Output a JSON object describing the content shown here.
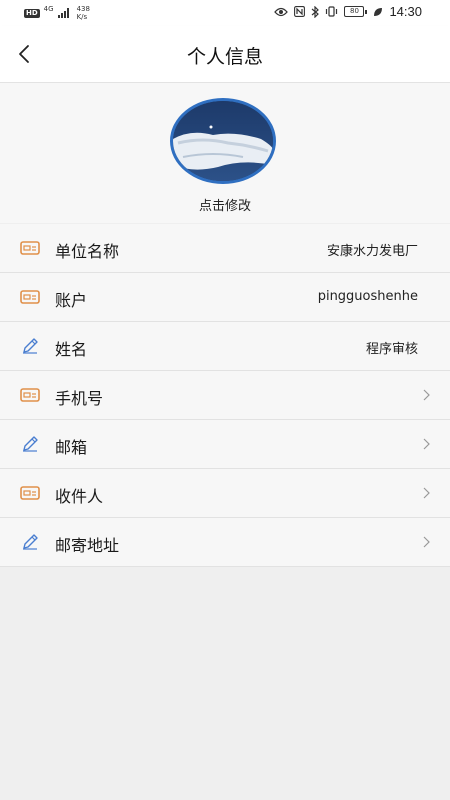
{
  "status_bar": {
    "hd": "HD",
    "network": "4G",
    "speed": "438\nK/s",
    "battery": "80",
    "time": "14:30",
    "icons": [
      "eye-icon",
      "nfc-icon",
      "bluetooth-icon",
      "vibrate-icon",
      "battery-icon",
      "leaf-icon"
    ]
  },
  "header": {
    "title": "个人信息",
    "back_icon": "chevron-left-icon"
  },
  "avatar": {
    "hint": "点击修改"
  },
  "rows": [
    {
      "label": "单位名称",
      "value": "安康水力发电厂",
      "icon": "id-card-icon",
      "chevron": false
    },
    {
      "label": "账户",
      "value": "pingguoshenhe",
      "icon": "id-card-icon",
      "chevron": false
    },
    {
      "label": "姓名",
      "value": "程序审核",
      "icon": "pencil-icon",
      "chevron": false
    },
    {
      "label": "手机号",
      "value": "",
      "icon": "id-card-icon",
      "chevron": true
    },
    {
      "label": "邮箱",
      "value": "",
      "icon": "pencil-icon",
      "chevron": true
    },
    {
      "label": "收件人",
      "value": "",
      "icon": "id-card-icon",
      "chevron": true
    },
    {
      "label": "邮寄地址",
      "value": "",
      "icon": "pencil-icon",
      "chevron": true
    }
  ],
  "colors": {
    "accent_blue": "#2f6fc1",
    "card_icon": "#e0904a",
    "pencil_icon": "#4a7ed0"
  }
}
